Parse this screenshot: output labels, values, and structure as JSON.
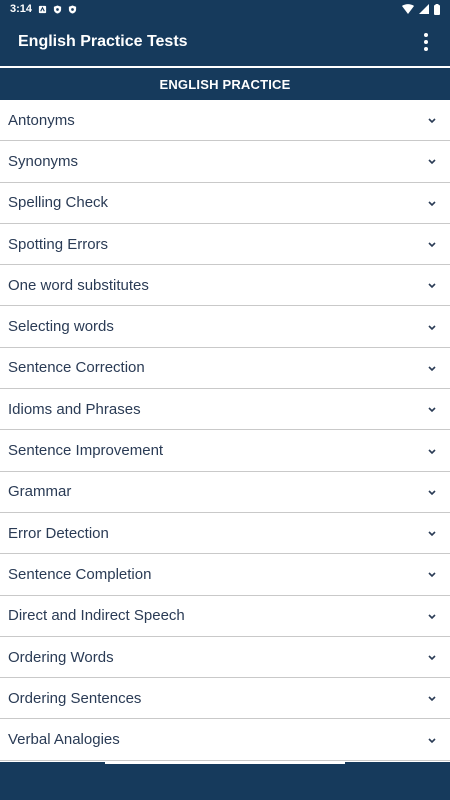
{
  "status_bar": {
    "time": "3:14",
    "icons_left": [
      "a-icon",
      "shield-icon",
      "shield-icon"
    ],
    "icons_right": [
      "wifi-icon",
      "signal-icon",
      "battery-icon"
    ]
  },
  "app_bar": {
    "title": "English Practice Tests",
    "menu_icon": "more-vert-icon"
  },
  "section": {
    "header": "ENGLISH PRACTICE"
  },
  "topics": [
    {
      "label": "Antonyms"
    },
    {
      "label": "Synonyms"
    },
    {
      "label": "Spelling Check"
    },
    {
      "label": "Spotting Errors"
    },
    {
      "label": "One word substitutes"
    },
    {
      "label": "Selecting words"
    },
    {
      "label": "Sentence Correction"
    },
    {
      "label": "Idioms and Phrases"
    },
    {
      "label": "Sentence Improvement"
    },
    {
      "label": "Grammar"
    },
    {
      "label": "Error Detection"
    },
    {
      "label": "Sentence Completion"
    },
    {
      "label": "Direct and Indirect Speech"
    },
    {
      "label": "Ordering Words"
    },
    {
      "label": "Ordering Sentences"
    },
    {
      "label": "Verbal Analogies"
    }
  ],
  "colors": {
    "primary": "#163a5c",
    "item_text": "#2a3b55",
    "divider": "#c9c9c9"
  }
}
